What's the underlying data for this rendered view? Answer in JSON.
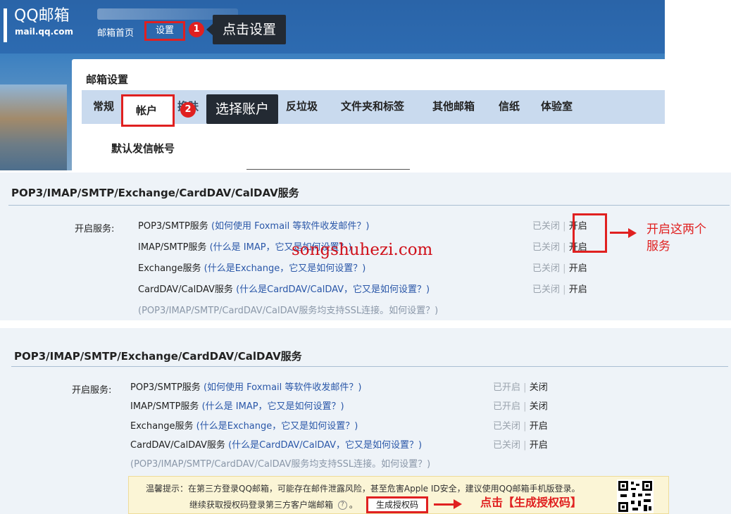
{
  "shot1": {
    "logo": {
      "title": "QQ邮箱",
      "domain": "mail.qq.com"
    },
    "nav": {
      "home": "邮箱首页",
      "settings": "设置"
    },
    "step1": {
      "badge": "1",
      "tip": "点击设置"
    },
    "panel": {
      "title": "邮箱设置",
      "tabs": [
        "常规",
        "帐户",
        "换肤",
        "反垃圾",
        "文件夹和标签",
        "其他邮箱",
        "信纸",
        "体验室"
      ],
      "step2": {
        "badge": "2",
        "tip": "选择账户"
      },
      "default_sender": "默认发信帐号"
    }
  },
  "svc1": {
    "title": "POP3/IMAP/SMTP/Exchange/CardDAV/CalDAV服务",
    "label": "开启服务:",
    "rows": [
      {
        "name": "POP3/SMTP服务",
        "help": "(如何使用 Foxmail 等软件收发邮件？)",
        "status": "已关闭",
        "sep": "|",
        "action": "开启"
      },
      {
        "name": "IMAP/SMTP服务",
        "help": "(什么是 IMAP，它又是如何设置？)",
        "status": "已关闭",
        "sep": "|",
        "action": "开启"
      },
      {
        "name": "Exchange服务",
        "help": "(什么是Exchange，它又是如何设置？)",
        "status": "已关闭",
        "sep": "|",
        "action": "开启"
      },
      {
        "name": "CardDAV/CalDAV服务",
        "help": "(什么是CardDAV/CalDAV，它又是如何设置？)",
        "status": "已关闭",
        "sep": "|",
        "action": "开启"
      }
    ],
    "note": "(POP3/IMAP/SMTP/CardDAV/CalDAV服务均支持SSL连接。如何设置？)",
    "annotation": [
      "开启这两个",
      "服务"
    ]
  },
  "watermark": "songshuhezi.com",
  "svc2": {
    "title": "POP3/IMAP/SMTP/Exchange/CardDAV/CalDAV服务",
    "label": "开启服务:",
    "rows": [
      {
        "name": "POP3/SMTP服务",
        "help": "(如何使用 Foxmail 等软件收发邮件？)",
        "status": "已开启",
        "sep": "|",
        "action": "关闭"
      },
      {
        "name": "IMAP/SMTP服务",
        "help": "(什么是 IMAP，它又是如何设置？)",
        "status": "已开启",
        "sep": "|",
        "action": "关闭"
      },
      {
        "name": "Exchange服务",
        "help": "(什么是Exchange，它又是如何设置？)",
        "status": "已关闭",
        "sep": "|",
        "action": "开启"
      },
      {
        "name": "CardDAV/CalDAV服务",
        "help": "(什么是CardDAV/CalDAV，它又是如何设置？)",
        "status": "已关闭",
        "sep": "|",
        "action": "开启"
      }
    ],
    "note": "(POP3/IMAP/SMTP/CardDAV/CalDAV服务均支持SSL连接。如何设置？)",
    "warning": {
      "line1": "温馨提示：在第三方登录QQ邮箱，可能存在邮件泄露风险，甚至危害Apple ID安全，建议使用QQ邮箱手机版登录。",
      "line2": "继续获取授权码登录第三方客户端邮箱",
      "help_icon": "?",
      "dot": "。",
      "button": "生成授权码"
    },
    "annotation": "点击【生成授权码】"
  },
  "colors": {
    "accent_red": "#e02020",
    "header_blue": "#2d6bb1",
    "tab_bar": "#c9daee",
    "panel_bg": "#eef3f8"
  }
}
